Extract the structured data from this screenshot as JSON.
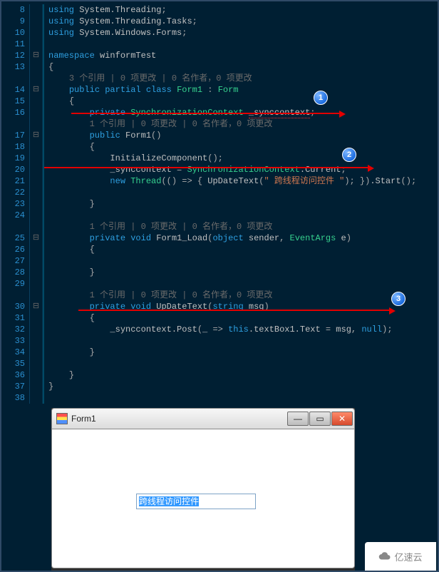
{
  "code": {
    "lines": [
      {
        "n": 8,
        "fold": "",
        "hl": "green",
        "ind": 0,
        "html": "<span class='kw'>using</span>&nbsp;System.Threading<span class='punc'>;</span>"
      },
      {
        "n": 9,
        "fold": "",
        "hl": "green",
        "ind": 0,
        "html": "<span class='kw'>using</span>&nbsp;System.Threading.Tasks<span class='punc'>;</span>"
      },
      {
        "n": 10,
        "fold": "",
        "hl": "green",
        "ind": 0,
        "html": "<span class='kw'>using</span>&nbsp;System.Windows.Forms<span class='punc'>;</span>"
      },
      {
        "n": 11,
        "fold": "",
        "hl": "",
        "ind": 0,
        "html": ""
      },
      {
        "n": 12,
        "fold": "⊟",
        "hl": "",
        "ind": 0,
        "html": "<span class='kw'>namespace</span>&nbsp;winformTest"
      },
      {
        "n": 13,
        "fold": "",
        "hl": "",
        "ind": 0,
        "html": "<span class='punc'>{</span>"
      },
      {
        "n": "",
        "fold": "",
        "hl": "",
        "ind": 2,
        "html": "<span class='mutedline'>3 个引用 | 0 项更改 | 0 名作者，0 项更改</span>"
      },
      {
        "n": 14,
        "fold": "⊟",
        "hl": "green",
        "ind": 2,
        "html": "<span class='kw'>public</span>&nbsp;<span class='kw'>partial</span>&nbsp;<span class='kw'>class</span>&nbsp;<span class='type'>Form1</span>&nbsp;<span class='punc'>:</span>&nbsp;<span class='type'>Form</span>"
      },
      {
        "n": 15,
        "fold": "",
        "hl": "green",
        "ind": 2,
        "html": "<span class='punc'>{</span>"
      },
      {
        "n": 16,
        "fold": "",
        "hl": "yellow",
        "ind": 4,
        "html": "<span class='kw'>private</span>&nbsp;<span class='type'>SynchronizationContext</span>&nbsp;<span class='squig'>_synccontext</span><span class='punc'>;</span>"
      },
      {
        "n": "",
        "fold": "",
        "hl": "",
        "ind": 4,
        "html": "<span class='mutedline'>1 个引用 | 0 项更改 | 0 名作者，0 项更改</span>"
      },
      {
        "n": 17,
        "fold": "⊟",
        "hl": "green",
        "ind": 4,
        "html": "<span class='kw'>public</span>&nbsp;Form1<span class='punc'>()</span>"
      },
      {
        "n": 18,
        "fold": "",
        "hl": "green",
        "ind": 4,
        "html": "<span class='punc'>{</span>"
      },
      {
        "n": 19,
        "fold": "",
        "hl": "green",
        "ind": 6,
        "html": "InitializeComponent<span class='punc'>()</span><span class='punc'>;</span>"
      },
      {
        "n": 20,
        "fold": "",
        "hl": "yellow",
        "ind": 6,
        "rowhi": true,
        "html": "_synccontext&nbsp;<span class='punc'>=</span>&nbsp;<span class='type'>SynchronizationContext</span>.Current<span class='punc'>;</span>"
      },
      {
        "n": 21,
        "fold": "",
        "hl": "yellow",
        "ind": 6,
        "html": "<span class='kw'>new</span>&nbsp;<span class='type'>Thread</span><span class='punc'>(</span><span class='punc'>()</span>&nbsp;<span class='punc'>=&gt;</span>&nbsp;<span class='punc'>{</span>&nbsp;UpDateText<span class='punc'>(</span><span class='str'>\" 跨线程访问控件 \"</span><span class='punc'>)</span><span class='punc'>;</span>&nbsp;<span class='punc'>}</span><span class='punc'>)</span>.Start<span class='punc'>()</span><span class='punc'>;</span>"
      },
      {
        "n": 22,
        "fold": "",
        "hl": "green",
        "ind": 6,
        "html": ""
      },
      {
        "n": 23,
        "fold": "",
        "hl": "green",
        "ind": 4,
        "html": "<span class='punc'>}</span>"
      },
      {
        "n": 24,
        "fold": "",
        "hl": "",
        "ind": 4,
        "html": ""
      },
      {
        "n": "",
        "fold": "",
        "hl": "",
        "ind": 4,
        "html": "<span class='mutedline'>1 个引用 | 0 项更改 | 0 名作者，0 项更改</span>"
      },
      {
        "n": 25,
        "fold": "⊟",
        "hl": "green",
        "ind": 4,
        "html": "<span class='kw'>private</span>&nbsp;<span class='kw'>void</span>&nbsp;Form1_Load<span class='punc'>(</span><span class='kw'>object</span>&nbsp;sender<span class='punc'>,</span>&nbsp;<span class='type'>EventArgs</span>&nbsp;e<span class='punc'>)</span>"
      },
      {
        "n": 26,
        "fold": "",
        "hl": "green",
        "ind": 4,
        "html": "<span class='punc'>{</span>"
      },
      {
        "n": 27,
        "fold": "",
        "hl": "green",
        "ind": 4,
        "html": ""
      },
      {
        "n": 28,
        "fold": "",
        "hl": "green",
        "ind": 4,
        "html": "<span class='punc'>}</span>"
      },
      {
        "n": 29,
        "fold": "",
        "hl": "",
        "ind": 4,
        "html": ""
      },
      {
        "n": "",
        "fold": "",
        "hl": "",
        "ind": 4,
        "html": "<span class='mutedline'>1 个引用 | 0 项更改 | 0 名作者，0 项更改</span>"
      },
      {
        "n": 30,
        "fold": "⊟",
        "hl": "green",
        "ind": 4,
        "html": "<span class='kw'>private</span>&nbsp;<span class='kw'>void</span>&nbsp;UpDateText<span class='punc'>(</span><span class='kw'>string</span>&nbsp;msg<span class='punc'>)</span>"
      },
      {
        "n": 31,
        "fold": "",
        "hl": "green",
        "ind": 4,
        "html": "<span class='punc'>{</span>"
      },
      {
        "n": 32,
        "fold": "",
        "hl": "yellow",
        "ind": 6,
        "html": "_synccontext.Post<span class='punc'>(</span>_&nbsp;<span class='punc'>=&gt;</span>&nbsp;<span class='kw'>this</span>.textBox1.Text&nbsp;<span class='punc'>=</span>&nbsp;msg<span class='punc'>,</span>&nbsp;<span class='kw'>null</span><span class='punc'>)</span><span class='punc'>;</span>"
      },
      {
        "n": 33,
        "fold": "",
        "hl": "green",
        "ind": 6,
        "html": ""
      },
      {
        "n": 34,
        "fold": "",
        "hl": "green",
        "ind": 4,
        "html": "<span class='punc'>}</span>"
      },
      {
        "n": 35,
        "fold": "",
        "hl": "green",
        "ind": 4,
        "html": ""
      },
      {
        "n": 36,
        "fold": "",
        "hl": "green",
        "ind": 2,
        "html": "<span class='punc'>}</span>"
      },
      {
        "n": 37,
        "fold": "",
        "hl": "",
        "ind": 0,
        "html": "<span class='punc'>}</span>"
      },
      {
        "n": 38,
        "fold": "",
        "hl": "",
        "ind": 0,
        "html": ""
      }
    ]
  },
  "annotations": {
    "b1": "1",
    "b2": "2",
    "b3": "3"
  },
  "form": {
    "title": "Form1",
    "textbox_value": "跨线程访问控件"
  },
  "watermark": "亿速云"
}
